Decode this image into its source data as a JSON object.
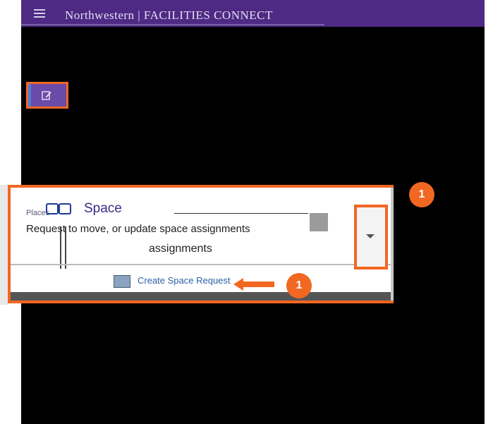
{
  "header": {
    "brand": "Northwestern | FACILITIES CONNECT"
  },
  "toolbar": {
    "edit_icon": "edit-pencil-icon"
  },
  "card": {
    "places_label": "Places",
    "title": "Space",
    "description": "Request to move, or update space assignments",
    "assignments": "assignments",
    "link_text": "Create Space Request",
    "dropdown_icon": "chevron-down-icon"
  },
  "badges": {
    "top": "1",
    "inline": "1"
  },
  "colors": {
    "brand_purple": "#4e2a84",
    "highlight_orange": "#f26722",
    "link_blue": "#2d5fa8"
  }
}
